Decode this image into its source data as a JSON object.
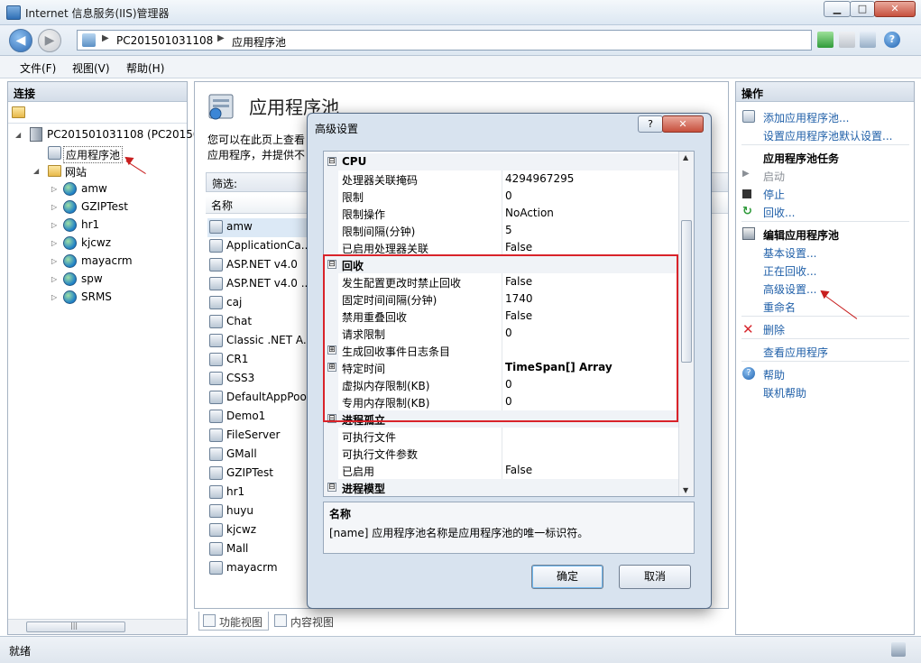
{
  "window": {
    "title": "Internet 信息服务(IIS)管理器",
    "min": "▁",
    "max": "□",
    "close": "✕"
  },
  "address": {
    "server": "PC201501031108",
    "page": "应用程序池",
    "back": "◀",
    "fwd": "▶",
    "help_icon": "?"
  },
  "menu": [
    "文件(F)",
    "视图(V)",
    "帮助(H)"
  ],
  "connections": {
    "header": "连接",
    "root": "PC201501031108 (PC20150",
    "pools_node": "应用程序池",
    "sites_node": "网站",
    "sites": [
      "amw",
      "GZIPTest",
      "hr1",
      "kjcwz",
      "mayacrm",
      "spw",
      "SRMS"
    ],
    "scroll_mark": "|||"
  },
  "center": {
    "title": "应用程序池",
    "desc_line1": "您可以在此页上查看",
    "desc_line2": "应用程序，并提供不",
    "filter_label": "筛选:",
    "col_name": "名称",
    "pools": [
      "amw",
      "ApplicationCa...",
      "ASP.NET v4.0",
      "ASP.NET v4.0 ...",
      "caj",
      "Chat",
      "Classic .NET A...",
      "CR1",
      "CSS3",
      "DefaultAppPool",
      "Demo1",
      "FileServer",
      "GMall",
      "GZIPTest",
      "hr1",
      "huyu",
      "kjcwz",
      "Mall",
      "mayacrm"
    ]
  },
  "bottom_tabs": {
    "features": "功能视图",
    "content": "内容视图"
  },
  "actions": {
    "header": "操作",
    "add_pool": "添加应用程序池...",
    "set_defaults": "设置应用程序池默认设置...",
    "tasks_head": "应用程序池任务",
    "start": "启动",
    "stop": "停止",
    "recycle": "回收...",
    "edit_head": "编辑应用程序池",
    "basic": "基本设置...",
    "recycling": "正在回收...",
    "advanced": "高级设置...",
    "rename": "重命名",
    "remove": "删除",
    "view_apps": "查看应用程序",
    "help": "帮助",
    "online_help": "联机帮助"
  },
  "status": {
    "text": "就绪"
  },
  "dialog": {
    "title": "高级设置",
    "help": "?",
    "close": "✕",
    "rows": [
      {
        "type": "cat",
        "exp": "⊟",
        "key": "CPU",
        "value": ""
      },
      {
        "type": "prop",
        "key": "处理器关联掩码",
        "value": "4294967295"
      },
      {
        "type": "prop",
        "key": "限制",
        "value": "0"
      },
      {
        "type": "prop",
        "key": "限制操作",
        "value": "NoAction"
      },
      {
        "type": "prop",
        "key": "限制间隔(分钟)",
        "value": "5"
      },
      {
        "type": "prop",
        "key": "已启用处理器关联",
        "value": "False"
      },
      {
        "type": "cat",
        "exp": "⊟",
        "key": "回收",
        "value": ""
      },
      {
        "type": "prop",
        "key": "发生配置更改时禁止回收",
        "value": "False"
      },
      {
        "type": "prop",
        "key": "固定时间间隔(分钟)",
        "value": "1740"
      },
      {
        "type": "prop",
        "key": "禁用重叠回收",
        "value": "False"
      },
      {
        "type": "prop",
        "key": "请求限制",
        "value": "0"
      },
      {
        "type": "sub",
        "exp": "⊞",
        "key": "生成回收事件日志条目",
        "value": ""
      },
      {
        "type": "sub",
        "exp": "⊞",
        "key": "特定时间",
        "value": "TimeSpan[] Array"
      },
      {
        "type": "prop",
        "key": "虚拟内存限制(KB)",
        "value": "0"
      },
      {
        "type": "prop",
        "key": "专用内存限制(KB)",
        "value": "0"
      },
      {
        "type": "cat",
        "exp": "⊟",
        "key": "进程孤立",
        "value": ""
      },
      {
        "type": "prop",
        "key": "可执行文件",
        "value": ""
      },
      {
        "type": "prop",
        "key": "可执行文件参数",
        "value": ""
      },
      {
        "type": "prop",
        "key": "已启用",
        "value": "False"
      },
      {
        "type": "cat",
        "exp": "⊟",
        "key": "进程模型",
        "value": ""
      }
    ],
    "desc_title": "名称",
    "desc_text": "[name] 应用程序池名称是应用程序池的唯一标识符。",
    "ok": "确定",
    "cancel": "取消",
    "scroll_up": "▲",
    "scroll_down": "▼"
  }
}
